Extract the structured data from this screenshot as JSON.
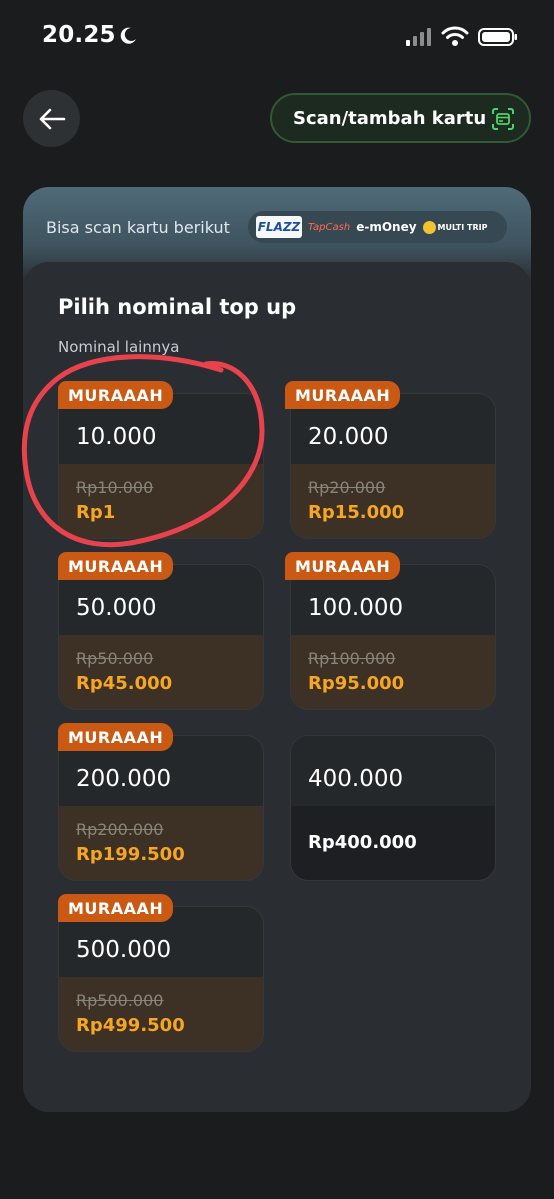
{
  "status_bar": {
    "time": "20.25"
  },
  "header": {
    "scan_button_label": "Scan/tambah kartu"
  },
  "cards_info": {
    "label": "Bisa scan kartu berikut",
    "logos": {
      "flazz": "FLAZZ",
      "tapcash": "TapCash",
      "emoney": "e-mOney",
      "multitrip": "MULTI TRIP"
    }
  },
  "topup": {
    "title": "Pilih nominal top up",
    "subtitle": "Nominal lainnya",
    "tiles": [
      {
        "badge": "MURAAAH",
        "nominal": "10.000",
        "old_price": "Rp10.000",
        "price": "Rp1"
      },
      {
        "badge": "MURAAAH",
        "nominal": "20.000",
        "old_price": "Rp20.000",
        "price": "Rp15.000"
      },
      {
        "badge": "MURAAAH",
        "nominal": "50.000",
        "old_price": "Rp50.000",
        "price": "Rp45.000"
      },
      {
        "badge": "MURAAAH",
        "nominal": "100.000",
        "old_price": "Rp100.000",
        "price": "Rp95.000"
      },
      {
        "badge": "MURAAAH",
        "nominal": "200.000",
        "old_price": "Rp200.000",
        "price": "Rp199.500"
      },
      {
        "nominal": "400.000",
        "price": "Rp400.000"
      },
      {
        "badge": "MURAAAH",
        "nominal": "500.000",
        "old_price": "Rp500.000",
        "price": "Rp499.500"
      }
    ]
  },
  "colors": {
    "background": "#1b1c1e",
    "accent_orange": "#f6a623",
    "badge": "#c95913",
    "annotation": "#e8434d",
    "scan_border": "#2f5a35",
    "scan_icon": "#4cd46a"
  }
}
